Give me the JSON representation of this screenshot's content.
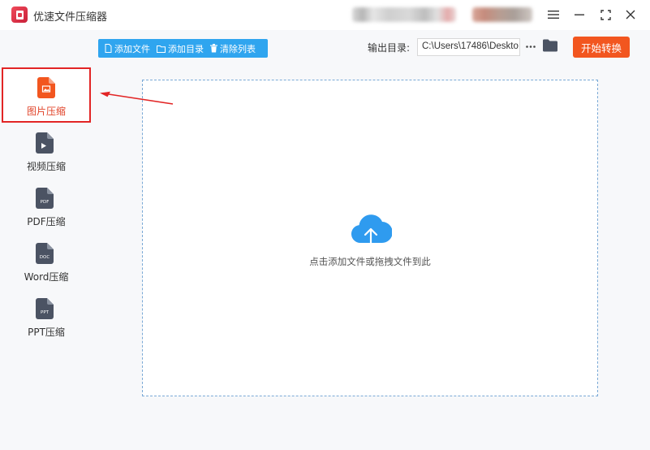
{
  "window": {
    "title": "优速文件压缩器",
    "icons": [
      "app-logo",
      "menu-icon",
      "minimize-icon",
      "maximize-icon",
      "close-icon"
    ]
  },
  "sidebar": {
    "items": [
      {
        "label": "图片压缩",
        "icon": "image-file-icon",
        "active": true
      },
      {
        "label": "视频压缩",
        "icon": "video-file-icon",
        "active": false
      },
      {
        "label": "PDF压缩",
        "icon": "pdf-file-icon",
        "icon_text": "PDF",
        "active": false
      },
      {
        "label": "Word压缩",
        "icon": "doc-file-icon",
        "icon_text": "DOC",
        "active": false
      },
      {
        "label": "PPT压缩",
        "icon": "ppt-file-icon",
        "icon_text": "PPT",
        "active": false
      }
    ]
  },
  "toolbar": {
    "add_file": "添加文件",
    "add_dir": "添加目录",
    "clear_list": "清除列表",
    "output_label": "输出目录:",
    "output_path": "C:\\Users\\17486\\Deskto",
    "more": "···",
    "start": "开始转换"
  },
  "dropzone": {
    "hint": "点击添加文件或拖拽文件到此"
  },
  "colors": {
    "accent_blue": "#2fa5ef",
    "start_orange": "#f2561f",
    "active_text": "#e1442a",
    "highlight_red": "#e22525",
    "file_icon_gray": "#4b5363",
    "cloud_blue": "#2f9bef"
  }
}
